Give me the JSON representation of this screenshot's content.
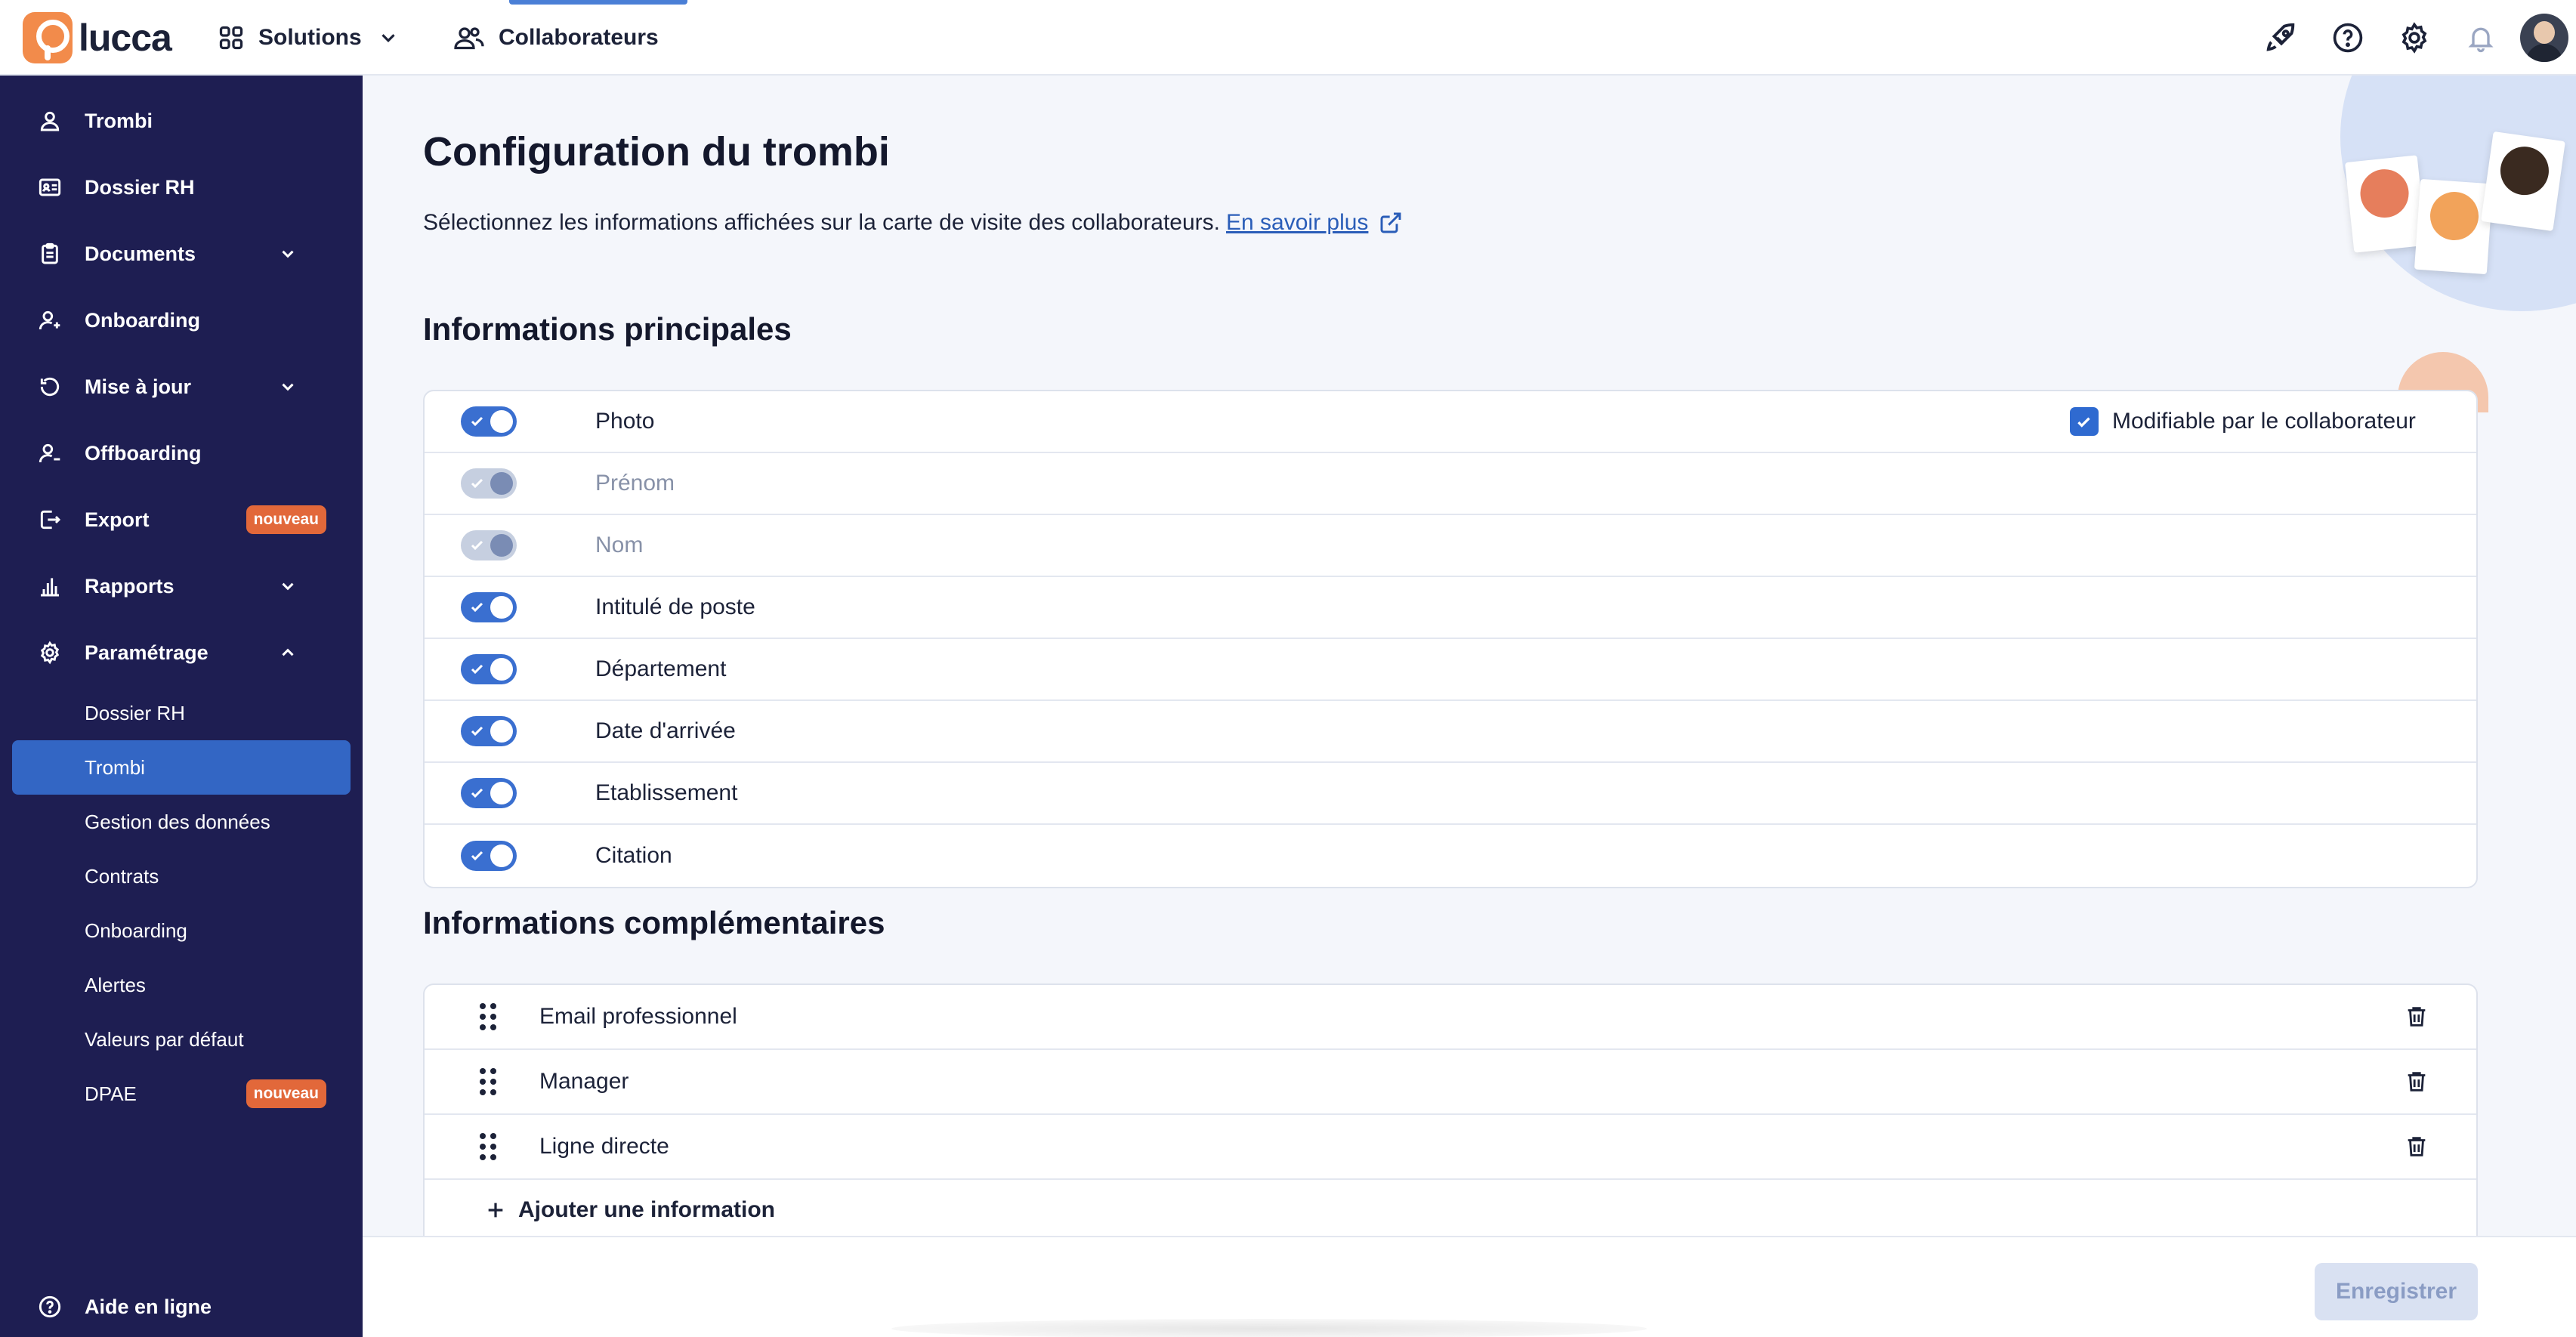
{
  "app": {
    "logo_text": "lucca"
  },
  "top_nav": {
    "solutions": "Solutions",
    "collaborateurs": "Collaborateurs"
  },
  "top_icons": [
    "rocket-icon",
    "help-icon",
    "gear-icon",
    "bell-icon",
    "avatar"
  ],
  "sidebar": {
    "items": [
      {
        "label": "Trombi",
        "icon": "user-icon"
      },
      {
        "label": "Dossier RH",
        "icon": "id-card-icon"
      },
      {
        "label": "Documents",
        "icon": "clipboard-icon",
        "chevron": "down"
      },
      {
        "label": "Onboarding",
        "icon": "user-plus-icon"
      },
      {
        "label": "Mise à jour",
        "icon": "refresh-icon",
        "chevron": "down"
      },
      {
        "label": "Offboarding",
        "icon": "user-minus-icon"
      },
      {
        "label": "Export",
        "icon": "export-icon",
        "badge": "nouveau"
      },
      {
        "label": "Rapports",
        "icon": "bar-chart-icon",
        "chevron": "down"
      },
      {
        "label": "Paramétrage",
        "icon": "settings-icon",
        "chevron": "up"
      }
    ],
    "sub_items": [
      {
        "label": "Dossier RH"
      },
      {
        "label": "Trombi",
        "active": true
      },
      {
        "label": "Gestion des données"
      },
      {
        "label": "Contrats"
      },
      {
        "label": "Onboarding"
      },
      {
        "label": "Alertes"
      },
      {
        "label": "Valeurs par défaut"
      },
      {
        "label": "DPAE",
        "badge": "nouveau"
      }
    ],
    "help": "Aide en ligne"
  },
  "main": {
    "title": "Configuration du trombi",
    "subtitle": "Sélectionnez les informations affichées sur la carte de visite des collaborateurs.",
    "learn_more": "En savoir plus",
    "principal_title": "Informations principales",
    "principal_rows": [
      {
        "label": "Photo",
        "enabled": true,
        "disabled": false
      },
      {
        "label": "Prénom",
        "enabled": true,
        "disabled": true
      },
      {
        "label": "Nom",
        "enabled": true,
        "disabled": true
      },
      {
        "label": "Intitulé de poste",
        "enabled": true,
        "disabled": false
      },
      {
        "label": "Département",
        "enabled": true,
        "disabled": false
      },
      {
        "label": "Date d'arrivée",
        "enabled": true,
        "disabled": false
      },
      {
        "label": "Etablissement",
        "enabled": true,
        "disabled": false
      },
      {
        "label": "Citation",
        "enabled": true,
        "disabled": false
      }
    ],
    "modifiable_label": "Modifiable par le collaborateur",
    "complementary_title": "Informations complémentaires",
    "complementary_rows": [
      {
        "label": "Email professionnel"
      },
      {
        "label": "Manager"
      },
      {
        "label": "Ligne directe"
      }
    ],
    "add_label": "Ajouter une information"
  },
  "footer": {
    "save_label": "Enregistrer"
  },
  "colors": {
    "sidebar": "#1e1e52",
    "accent": "#3366c4",
    "badge": "#e2683a",
    "toggle_on": "#3a6fd0"
  }
}
